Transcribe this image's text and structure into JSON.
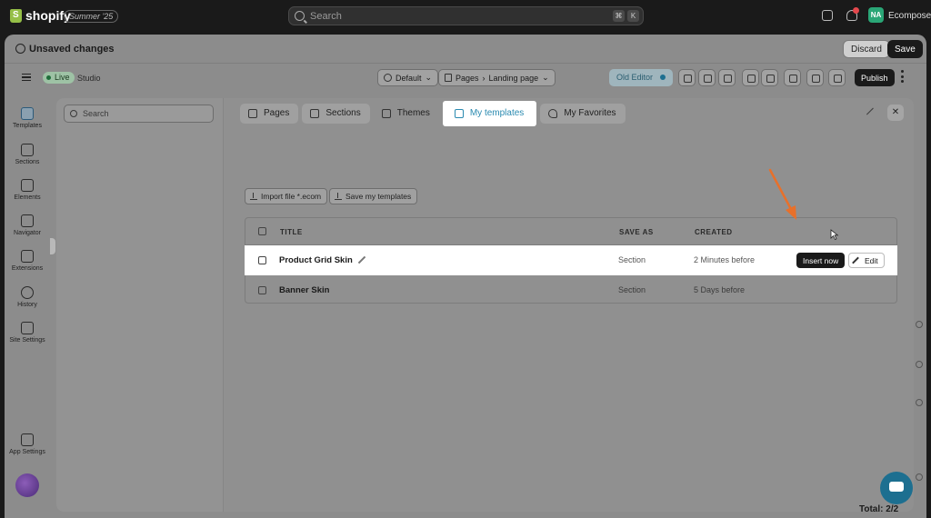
{
  "shopify": {
    "brand": "shopify",
    "edition": "Summer '25",
    "search_placeholder": "Search",
    "shortcut_keys": [
      "⌘",
      "K"
    ],
    "store_initials": "NA",
    "store_name": "Ecomposer"
  },
  "save_bar": {
    "message": "Unsaved changes",
    "discard_label": "Discard",
    "save_label": "Save"
  },
  "editor_bar": {
    "status": "Live",
    "mode": "Studio",
    "theme_select": "Default",
    "page_type": "Pages",
    "page_name": "Landing page",
    "old_editor_label": "Old Editor",
    "publish_label": "Publish"
  },
  "rail": [
    {
      "label": "Templates",
      "icon": "templates-icon"
    },
    {
      "label": "Sections",
      "icon": "sections-icon"
    },
    {
      "label": "Elements",
      "icon": "elements-icon"
    },
    {
      "label": "Navigator",
      "icon": "navigator-icon"
    },
    {
      "label": "Extensions",
      "icon": "extensions-icon"
    },
    {
      "label": "History",
      "icon": "history-icon"
    },
    {
      "label": "Site Settings",
      "icon": "site-settings-icon"
    },
    {
      "label": "App Settings",
      "icon": "app-settings-icon"
    }
  ],
  "modal": {
    "search_placeholder": "Search",
    "tabs": [
      {
        "label": "Pages",
        "icon": "page-icon"
      },
      {
        "label": "Sections",
        "icon": "sections-icon"
      },
      {
        "label": "Themes",
        "icon": "themes-icon"
      },
      {
        "label": "My templates",
        "icon": "folder-icon"
      },
      {
        "label": "My Favorites",
        "icon": "heart-icon"
      }
    ],
    "active_tab": "My templates",
    "import_label": "Import file *.ecom",
    "save_templates_label": "Save my templates",
    "table": {
      "headers": {
        "title": "TITLE",
        "save_as": "SAVE AS",
        "created": "CREATED"
      },
      "rows": [
        {
          "title": "Product Grid Skin",
          "save_as": "Section",
          "created": "2 Minutes before",
          "insert_label": "Insert now",
          "edit_label": "Edit"
        },
        {
          "title": "Banner Skin",
          "save_as": "Section",
          "created": "5 Days before"
        }
      ]
    },
    "total": "Total: 2/2"
  },
  "colors": {
    "accent": "#2a8ab0",
    "annotation_arrow": "#e8702a",
    "live_green": "#1e6e3a"
  }
}
